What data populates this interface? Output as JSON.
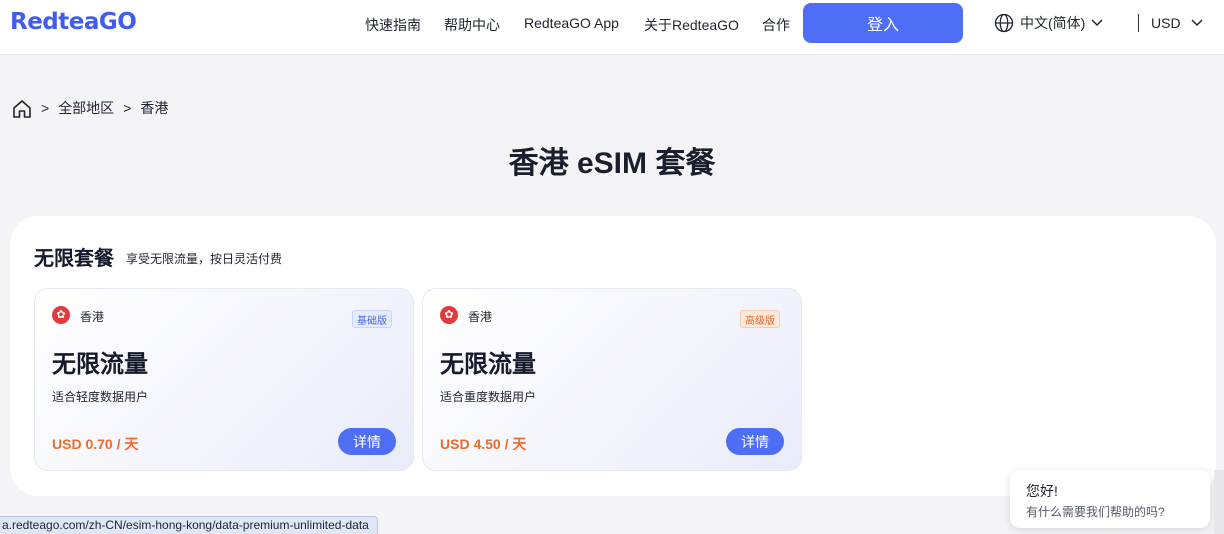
{
  "header": {
    "logo": "RedteaGO",
    "nav": [
      "快速指南",
      "帮助中心",
      "RedteaGO App",
      "关于RedteaGO",
      "合作"
    ],
    "login_label": "登入",
    "language": "中文(简体)",
    "currency": "USD"
  },
  "breadcrumb": {
    "home_icon": "home-icon",
    "items": [
      "全部地区",
      "香港"
    ],
    "separator": ">"
  },
  "page_title": "香港 eSIM 套餐",
  "section": {
    "title": "无限套餐",
    "subtitle": "享受无限流量，按日灵活付费"
  },
  "cards": [
    {
      "region": "香港",
      "tier": "基础版",
      "name": "无限流量",
      "desc": "适合轻度数据用户",
      "price": "USD 0.70 / 天",
      "button": "详情"
    },
    {
      "region": "香港",
      "tier": "高级版",
      "name": "无限流量",
      "desc": "适合重度数据用户",
      "price": "USD 4.50 / 天",
      "button": "详情"
    }
  ],
  "status_url": "a.redteago.com/zh-CN/esim-hong-kong/data-premium-unlimited-data",
  "chat": {
    "greeting": "您好!",
    "prompt": "有什么需要我们帮助的吗?"
  },
  "colors": {
    "brand": "#3f5ef0",
    "button": "#4d6ef5",
    "price": "#ef6a2c"
  }
}
